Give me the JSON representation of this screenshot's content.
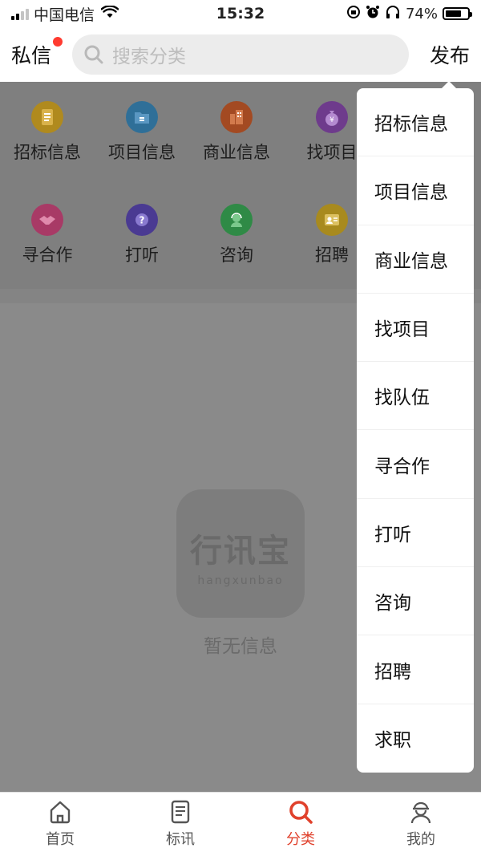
{
  "status_bar": {
    "carrier": "中国电信",
    "time": "15:32",
    "battery": "74%",
    "battery_level": 0.74
  },
  "header": {
    "messages_label": "私信",
    "search_placeholder": "搜索分类",
    "publish_label": "发布"
  },
  "categories": [
    {
      "label": "招标信息",
      "icon": "document-icon",
      "color": "#b08a1e"
    },
    {
      "label": "项目信息",
      "icon": "folder-icon",
      "color": "#2f6f98"
    },
    {
      "label": "商业信息",
      "icon": "building-icon",
      "color": "#a34a22"
    },
    {
      "label": "找项目",
      "icon": "money-bag-icon",
      "color": "#6e3b8c"
    },
    {
      "label": "寻合作",
      "icon": "handshake-icon",
      "color": "#a83a66"
    },
    {
      "label": "打听",
      "icon": "question-icon",
      "color": "#4a3a92"
    },
    {
      "label": "咨询",
      "icon": "support-icon",
      "color": "#2f8a46"
    },
    {
      "label": "招聘",
      "icon": "recruit-icon",
      "color": "#a88a1e"
    }
  ],
  "empty_state": {
    "logo_text": "行讯宝",
    "logo_subtext": "hangxunbao",
    "message": "暂无信息"
  },
  "dropdown_menu": [
    "招标信息",
    "项目信息",
    "商业信息",
    "找项目",
    "找队伍",
    "寻合作",
    "打听",
    "咨询",
    "招聘",
    "求职"
  ],
  "tab_bar": [
    {
      "label": "首页",
      "icon": "home-icon",
      "active": false
    },
    {
      "label": "标讯",
      "icon": "document-icon",
      "active": false
    },
    {
      "label": "分类",
      "icon": "search-icon",
      "active": true
    },
    {
      "label": "我的",
      "icon": "user-icon",
      "active": false
    }
  ],
  "colors": {
    "accent": "#e0412c",
    "notification_dot": "#ff3b30"
  }
}
